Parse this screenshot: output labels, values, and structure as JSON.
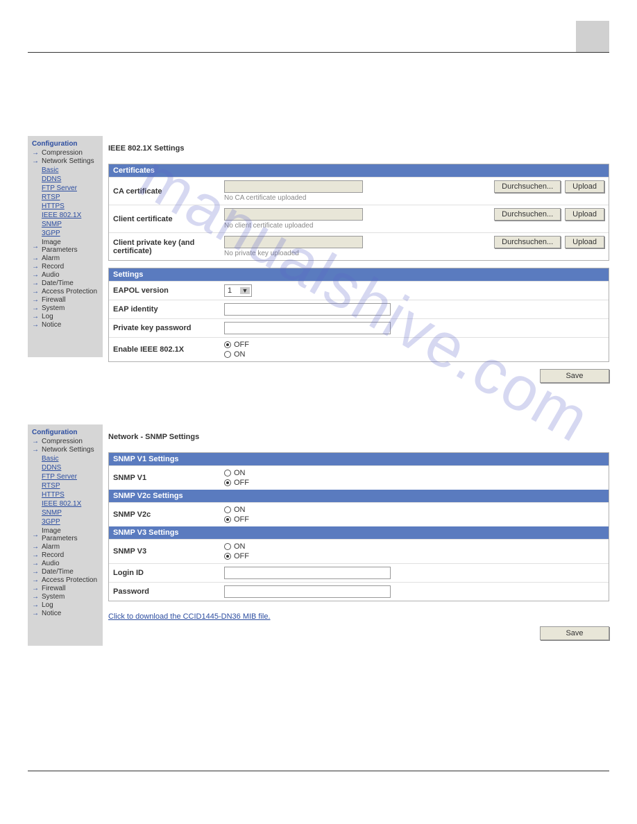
{
  "watermark": "manualshive.com",
  "sidebar": {
    "title": "Configuration",
    "items": [
      {
        "label": "Compression"
      },
      {
        "label": "Network Settings"
      },
      {
        "label": "Image Parameters"
      },
      {
        "label": "Alarm"
      },
      {
        "label": "Record"
      },
      {
        "label": "Audio"
      },
      {
        "label": "Date/Time"
      },
      {
        "label": "Access Protection"
      },
      {
        "label": "Firewall"
      },
      {
        "label": "System"
      },
      {
        "label": "Log"
      },
      {
        "label": "Notice"
      }
    ],
    "subs": [
      "Basic",
      "DDNS",
      "FTP Server",
      "RTSP",
      "HTTPS",
      "IEEE 802.1X",
      "SNMP",
      "3GPP"
    ]
  },
  "panel1": {
    "title": "IEEE 802.1X Settings",
    "certs_header": "Certificates",
    "settings_header": "Settings",
    "rows": {
      "ca_label": "CA certificate",
      "ca_status": "No CA certificate uploaded",
      "client_label": "Client certificate",
      "client_status": "No client certificate uploaded",
      "key_label": "Client private key (and certificate)",
      "key_status": "No private key uploaded",
      "browse_btn": "Durchsuchen...",
      "upload_btn": "Upload",
      "eapol_label": "EAPOL version",
      "eapol_value": "1",
      "eap_identity_label": "EAP identity",
      "pk_pass_label": "Private key password",
      "enable_label": "Enable IEEE 802.1X",
      "off": "OFF",
      "on": "ON"
    },
    "save": "Save"
  },
  "panel2": {
    "title": "Network - SNMP Settings",
    "h1": "SNMP V1 Settings",
    "h2": "SNMP V2c Settings",
    "h3": "SNMP V3 Settings",
    "v1_label": "SNMP V1",
    "v2_label": "SNMP V2c",
    "v3_label": "SNMP V3",
    "login_label": "Login ID",
    "pass_label": "Password",
    "on": "ON",
    "off": "OFF",
    "link": "Click to download the CCID1445-DN36 MIB file.",
    "save": "Save"
  }
}
